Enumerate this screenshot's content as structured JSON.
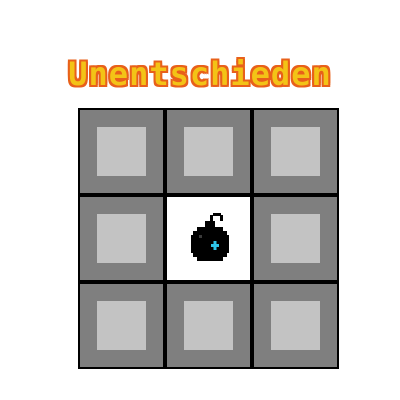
{
  "game": {
    "title": "Unentschieden",
    "rows": 3,
    "cols": 3,
    "cells": [
      {
        "state": "covered",
        "content": ""
      },
      {
        "state": "covered",
        "content": ""
      },
      {
        "state": "covered",
        "content": ""
      },
      {
        "state": "covered",
        "content": ""
      },
      {
        "state": "revealed",
        "content": "mine"
      },
      {
        "state": "covered",
        "content": ""
      },
      {
        "state": "covered",
        "content": ""
      },
      {
        "state": "covered",
        "content": ""
      },
      {
        "state": "covered",
        "content": ""
      }
    ]
  },
  "colors": {
    "title_fill": "#f3c316",
    "title_outline": "#e8601a",
    "grid_line": "#000000",
    "tile_outer": "#7f7f7f",
    "tile_inner": "#c3c3c3",
    "revealed_bg": "#ffffff",
    "mine_body": "#000000",
    "mine_highlight": "#2ec4e8"
  },
  "icons": {
    "mine": "bomb-icon"
  }
}
